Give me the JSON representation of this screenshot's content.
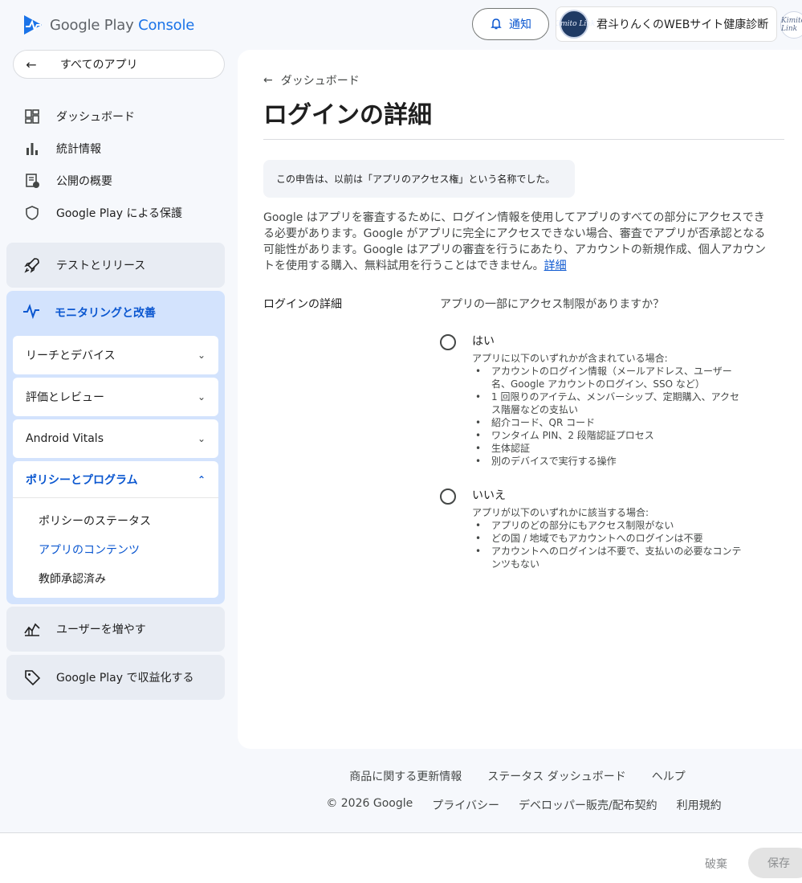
{
  "header": {
    "logo_brand": "Google Play",
    "logo_product": "Console",
    "notify_label": "通知",
    "account_name": "君斗りんくのWEBサイト健康診断",
    "avatar_text": "Kimito Link"
  },
  "sidebar": {
    "back_all": "すべてのアプリ",
    "items": [
      {
        "label": "ダッシュボード",
        "icon": "dashboard-icon"
      },
      {
        "label": "統計情報",
        "icon": "bar-chart-icon"
      },
      {
        "label": "公開の概要",
        "icon": "publish-overview-icon"
      },
      {
        "label": "Google Play による保護",
        "icon": "shield-icon"
      }
    ],
    "test_release": "テストとリリース",
    "monitor": "モニタリングと改善",
    "monitor_sub": [
      {
        "label": "リーチとデバイス"
      },
      {
        "label": "評価とレビュー"
      },
      {
        "label": "Android Vitals"
      }
    ],
    "policy": "ポリシーとプログラム",
    "policy_sub": [
      {
        "label": "ポリシーのステータス"
      },
      {
        "label": "アプリのコンテンツ"
      },
      {
        "label": "教師承認済み"
      }
    ],
    "grow_users": "ユーザーを増やす",
    "monetize": "Google Play で収益化する"
  },
  "main": {
    "breadcrumb": "ダッシュボード",
    "title": "ログインの詳細",
    "notice": "この申告は、以前は「アプリのアクセス権」という名称でした。",
    "description": "Google はアプリを審査するために、ログイン情報を使用してアプリのすべての部分にアクセスできる必要があります。Google がアプリに完全にアクセスできない場合、審査でアプリが否承認となる可能性があります。Google はアプリの審査を行うにあたり、アカウントの新規作成、個人アカウントを使用する購入、無料試用を行うことはできません。",
    "learn_more": "詳細",
    "field_label": "ログインの詳細",
    "question": "アプリの一部にアクセス制限がありますか？",
    "option_yes": {
      "title": "はい",
      "sub": "アプリに以下のいずれかが含まれている場合:",
      "items": [
        "アカウントのログイン情報（メールアドレス、ユーザー名、Google アカウントのログイン、SSO など）",
        "1 回限りのアイテム、メンバーシップ、定期購入、アクセス階層などの支払い",
        "紹介コード、QR コード",
        "ワンタイム PIN、2 段階認証プロセス",
        "生体認証",
        "別のデバイスで実行する操作"
      ]
    },
    "option_no": {
      "title": "いいえ",
      "sub": "アプリが以下のいずれかに該当する場合:",
      "items": [
        "アプリのどの部分にもアクセス制限がない",
        "どの国 / 地域でもアカウントへのログインは不要",
        "アカウントへのログインは不要で、支払いの必要なコンテンツもない"
      ]
    }
  },
  "footer": {
    "links": [
      "商品に関する更新情報",
      "ステータス ダッシュボード",
      "ヘルプ"
    ],
    "copyright": "© 2026 Google",
    "links2": [
      "プライバシー",
      "デベロッパー販売/配布契約",
      "利用規約"
    ]
  },
  "actions": {
    "discard": "破棄",
    "save": "保存"
  },
  "colors": {
    "accent": "#0b57d0",
    "monitor_bg": "#d3e3fd",
    "section_bg": "#e8ecf3",
    "page_bg": "#f6f8fc"
  }
}
